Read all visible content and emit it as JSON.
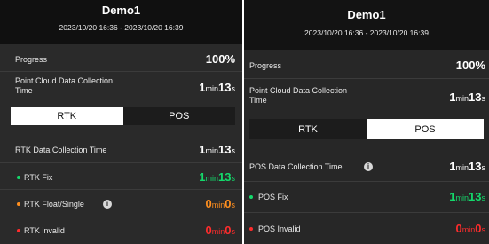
{
  "left": {
    "title": "Demo1",
    "time_range": "2023/10/20 16:36 - 2023/10/20 16:39",
    "progress_label": "Progress",
    "progress_value": "100%",
    "pc_time_label": "Point Cloud Data Collection Time",
    "pc_time_min": "1",
    "pc_time_min_unit": "min",
    "pc_time_sec": "13",
    "pc_time_sec_unit": "s",
    "tabs": [
      {
        "label": "RTK",
        "active": true
      },
      {
        "label": "POS",
        "active": false
      }
    ],
    "section_label": "RTK Data Collection Time",
    "section_min": "1",
    "section_min_unit": "min",
    "section_sec": "13",
    "section_sec_unit": "s",
    "items": [
      {
        "label": "RTK Fix",
        "min": "1",
        "min_unit": "min",
        "sec": "13",
        "sec_unit": "s",
        "color": "#14d96b"
      },
      {
        "label": "RTK Float/Single",
        "min": "0",
        "min_unit": "min",
        "sec": "0",
        "sec_unit": "s",
        "color": "#ff8f1f"
      },
      {
        "label": "RTK invalid",
        "min": "0",
        "min_unit": "min",
        "sec": "0",
        "sec_unit": "s",
        "color": "#ff2c2c"
      }
    ]
  },
  "right": {
    "title": "Demo1",
    "time_range": "2023/10/20 16:36 - 2023/10/20 16:39",
    "progress_label": "Progress",
    "progress_value": "100%",
    "pc_time_label": "Point Cloud Data Collection Time",
    "pc_time_min": "1",
    "pc_time_min_unit": "min",
    "pc_time_sec": "13",
    "pc_time_sec_unit": "s",
    "tabs": [
      {
        "label": "RTK",
        "active": false
      },
      {
        "label": "POS",
        "active": true
      }
    ],
    "section_label": "POS Data Collection Time",
    "section_min": "1",
    "section_min_unit": "min",
    "section_sec": "13",
    "section_sec_unit": "s",
    "items": [
      {
        "label": "POS Fix",
        "min": "1",
        "min_unit": "min",
        "sec": "13",
        "sec_unit": "s",
        "color": "#14d96b"
      },
      {
        "label": "POS Invalid",
        "min": "0",
        "min_unit": "min",
        "sec": "0",
        "sec_unit": "s",
        "color": "#ff2c2c"
      }
    ]
  },
  "colors": {
    "panel_bg": "#2a2a2a",
    "header_bg": "#101010",
    "fix": "#14d96b",
    "float": "#ff8f1f",
    "invalid": "#ff2c2c"
  },
  "icons": [
    "info-icon",
    "status-dot-icon"
  ]
}
